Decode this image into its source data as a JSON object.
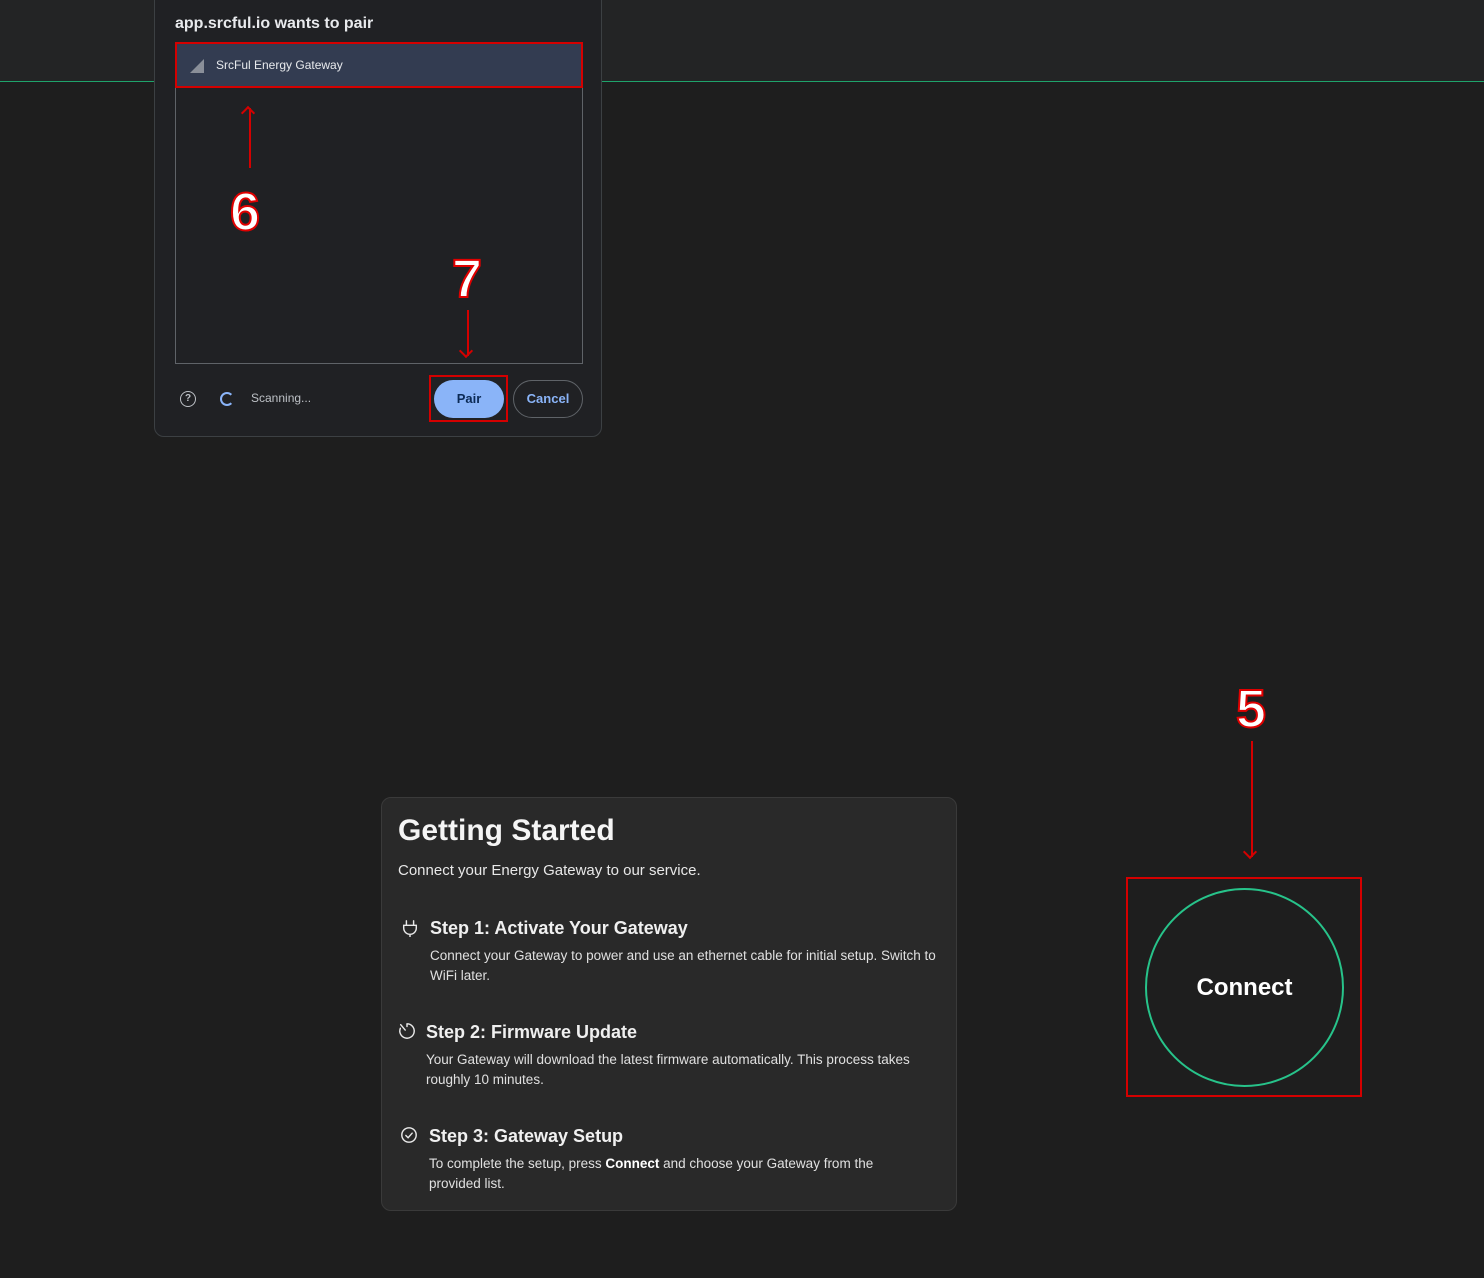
{
  "dialog": {
    "title": "app.srcful.io wants to pair",
    "device_name": "SrcFul Energy Gateway",
    "help_icon_glyph": "?",
    "status_text": "Scanning...",
    "pair_label": "Pair",
    "cancel_label": "Cancel"
  },
  "annotations": {
    "step5": "5",
    "step6": "6",
    "step7": "7"
  },
  "card": {
    "title": "Getting Started",
    "subtitle": "Connect your Energy Gateway to our service.",
    "steps": [
      {
        "icon": "plug-icon",
        "title": "Step 1: Activate Your Gateway",
        "description": "Connect your Gateway to power and use an ethernet cable for initial setup. Switch to WiFi later."
      },
      {
        "icon": "timer-icon",
        "title": "Step 2: Firmware Update",
        "description": "Your Gateway will download the latest firmware automatically. This process takes roughly 10 minutes."
      },
      {
        "icon": "check-circle-icon",
        "title": "Step 3: Gateway Setup",
        "description_before": "To complete the setup, press ",
        "description_bold": "Connect",
        "description_after": " and choose your Gateway from the provided list."
      }
    ]
  },
  "connect_label": "Connect",
  "colors": {
    "accent_green": "#27c38a",
    "dialog_blue": "#8ab4f8",
    "annotation_red": "#d40000",
    "selected_row": "#333c51"
  }
}
